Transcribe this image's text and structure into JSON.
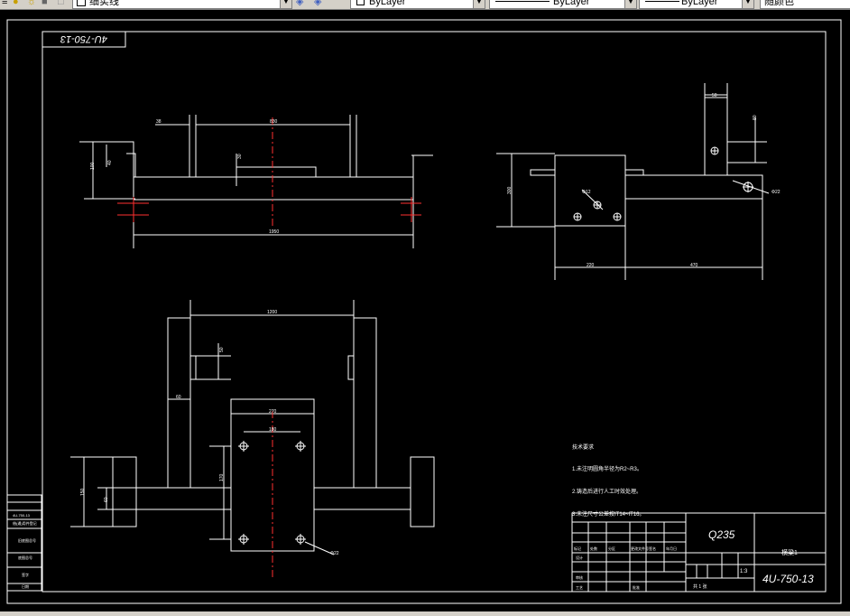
{
  "toolbar": {
    "layer_name": "细实线",
    "color_control": "ByLayer",
    "linetype_control": "ByLayer",
    "lineweight_control": "ByLayer",
    "plotstyle_control": "随颜色"
  },
  "drawing": {
    "mirrored_code": "4U-750-13",
    "technical_title": "技术要求",
    "note_1": "1.未注明圆角半径为R2~R3。",
    "note_2": "2.铸造后进行人工时效处理。",
    "note_3": "3.未注尺寸公差按IT14~IT16。",
    "material": "Q235",
    "part_name": "横梁1",
    "drawing_code": "4U-750-13",
    "scale": "1:3",
    "sheet": "共 1 张",
    "row_marks": [
      "标记",
      "处数",
      "分区",
      "更改文件号",
      "签名",
      "年月日"
    ],
    "row_roles": [
      "设计",
      "审核",
      "工艺",
      "批准"
    ],
    "left_stamps": [
      "4U-750-13",
      "借(通)用件登记",
      "旧底图总号",
      "底图总号",
      "签字",
      "日期"
    ],
    "dims": {
      "top_width": "1950",
      "top_inner": "830",
      "top_left": "38",
      "top_height": "100",
      "top_small": "40",
      "top_flange": "30",
      "right_width": "470",
      "right_left": "220",
      "right_top": "80",
      "right_hole": "Φ22",
      "right_height": "300",
      "right_tab": "50",
      "right_hole2": "Φ12",
      "bottom_width": "1200",
      "bottom_plate": "270",
      "bottom_holes": "180",
      "bottom_side": "60",
      "bottom_hole": "Φ22",
      "bottom_height": "170",
      "bottom_wheel": "150",
      "bottom_wheel_inner": "60",
      "bottom_slot": "50"
    }
  }
}
